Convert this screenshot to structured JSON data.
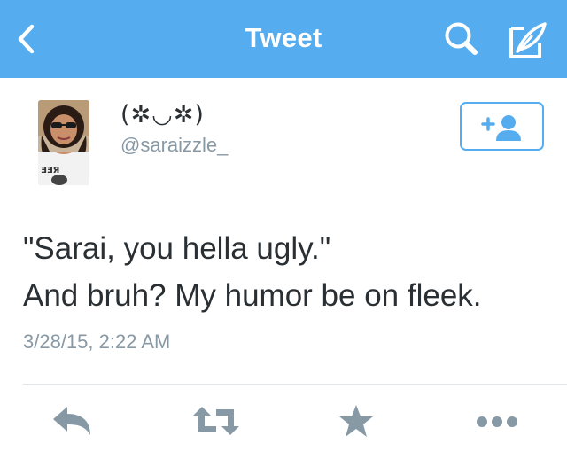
{
  "nav": {
    "title": "Tweet",
    "icons": [
      "back-chevron-icon",
      "search-icon",
      "compose-icon"
    ],
    "background_color": "#55acee"
  },
  "tweet": {
    "display_name": "(✲◡✲)",
    "screen_name": "@saraizzle_",
    "text_lines": [
      "\"Sarai, you hella ugly.\"",
      "And bruh? My humor be on fleek."
    ],
    "timestamp": "3/28/15, 2:22 AM",
    "follow_icon": "add-user-icon"
  },
  "actions": [
    {
      "name": "reply",
      "icon": "reply-icon"
    },
    {
      "name": "retweet",
      "icon": "retweet-icon"
    },
    {
      "name": "favorite",
      "icon": "star-icon"
    },
    {
      "name": "more",
      "icon": "more-dots-icon"
    }
  ],
  "colors": {
    "accent": "#55acee",
    "text": "#292f33",
    "secondary_text": "#8899a6",
    "action_icon": "#8899a6"
  }
}
